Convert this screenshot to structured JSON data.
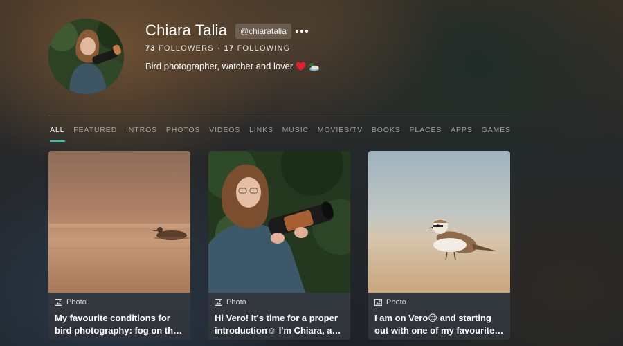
{
  "profile": {
    "name": "Chiara Talia",
    "handle": "@chiaratalia",
    "followers_count": "73",
    "followers_label": "FOLLOWERS",
    "separator": "·",
    "following_count": "17",
    "following_label": "FOLLOWING",
    "bio": "Bird photographer, watcher and lover",
    "bio_emojis": [
      "heart-emoji",
      "duck-emoji"
    ]
  },
  "tabs": [
    {
      "label": "ALL",
      "active": true
    },
    {
      "label": "FEATURED",
      "active": false
    },
    {
      "label": "INTROS",
      "active": false
    },
    {
      "label": "PHOTOS",
      "active": false
    },
    {
      "label": "VIDEOS",
      "active": false
    },
    {
      "label": "LINKS",
      "active": false
    },
    {
      "label": "MUSIC",
      "active": false
    },
    {
      "label": "MOVIES/TV",
      "active": false
    },
    {
      "label": "BOOKS",
      "active": false
    },
    {
      "label": "PLACES",
      "active": false
    },
    {
      "label": "APPS",
      "active": false
    },
    {
      "label": "GAMES",
      "active": false
    }
  ],
  "posts": [
    {
      "type": "Photo",
      "icon": "photo-icon",
      "caption": "My favourite conditions for bird photography: fog on the lake at sunrise"
    },
    {
      "type": "Photo",
      "icon": "photo-icon",
      "caption": "Hi Vero! It's time for a proper introduction☺ I'm Chiara, a bird photographer"
    },
    {
      "type": "Photo",
      "icon": "photo-icon",
      "caption": "I am on Vero😊 and starting out with one of my favourite birds"
    }
  ],
  "colors": {
    "accent": "#27c4b6",
    "card_meta_bg": "#33393f",
    "heart": "#e0202a"
  }
}
